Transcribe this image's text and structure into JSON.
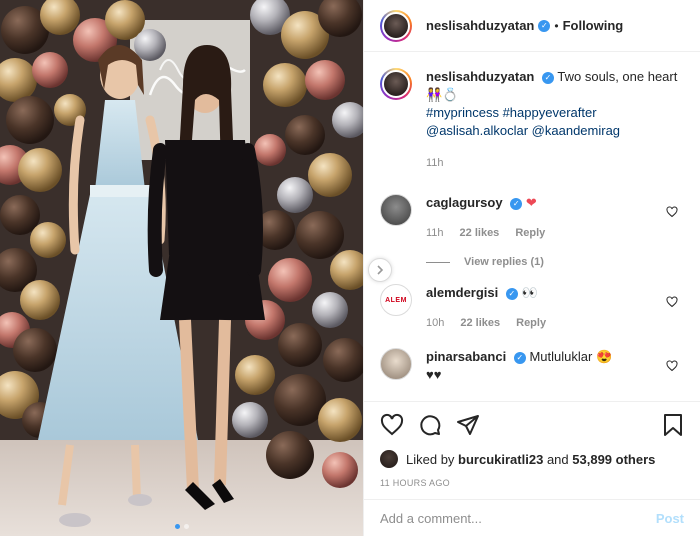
{
  "post": {
    "author": "neslisahduzyatan",
    "follow_state": "Following",
    "separator": "•"
  },
  "caption": {
    "username": "neslisahduzyatan",
    "text": "Two souls, one heart",
    "emojis": "👭💍",
    "hashtags": "#myprincess #happyeverafter",
    "mentions": "@aslisah.alkoclar @kaandemirag",
    "time": "11h"
  },
  "comments": [
    {
      "username": "caglagursoy",
      "text": "",
      "emoji": "❤",
      "time": "11h",
      "likes": "22 likes",
      "reply": "Reply",
      "view_replies": "View replies (1)"
    },
    {
      "username": "alemdergisi",
      "avatar_text": "ALEM",
      "text": "",
      "emoji": "👀",
      "time": "10h",
      "likes": "22 likes",
      "reply": "Reply"
    },
    {
      "username": "pinarsabanci",
      "text": "Mutluluklar",
      "emoji": "😍",
      "second_line": "♥♥"
    }
  ],
  "likes": {
    "prefix": "Liked by",
    "user": "burcukiratli23",
    "conjunction": "and",
    "others": "53,899 others"
  },
  "timestamp": "11 HOURS AGO",
  "add_comment": {
    "placeholder": "Add a comment...",
    "post_label": "Post"
  },
  "colors": {
    "verified": "#3897f0",
    "hashtag": "#00376b",
    "muted": "#8e8e8e",
    "post_disabled": "#b2dffc"
  }
}
